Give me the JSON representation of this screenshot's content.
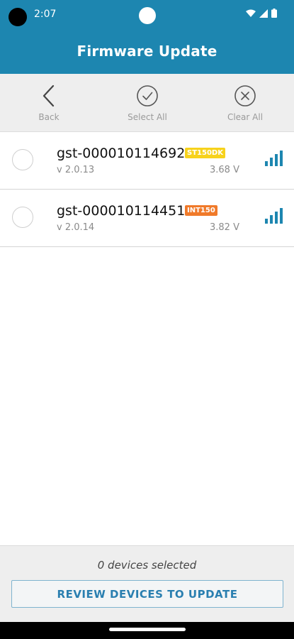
{
  "status_bar": {
    "time": "2:07",
    "icons": [
      "wifi-icon",
      "cell-signal-icon",
      "battery-icon"
    ]
  },
  "header": {
    "title": "Firmware Update"
  },
  "toolbar": {
    "back_label": "Back",
    "select_all_label": "Select All",
    "clear_all_label": "Clear All"
  },
  "devices": [
    {
      "name": "gst-000010114692",
      "badge": "ST150DK",
      "badge_color": "#f7d21c",
      "version": "v 2.0.13",
      "voltage": "3.68 V",
      "signal_bars": 4,
      "selected": false
    },
    {
      "name": "gst-000010114451",
      "badge": "INT150",
      "badge_color": "#f07a2a",
      "version": "v 2.0.14",
      "voltage": "3.82 V",
      "signal_bars": 4,
      "selected": false
    }
  ],
  "footer": {
    "selected_text": "0 devices selected",
    "review_button_label": "REVIEW DEVICES TO UPDATE"
  },
  "colors": {
    "primary": "#1d86b0",
    "button_text": "#2a7fb0",
    "signal": "#1d86b0"
  }
}
